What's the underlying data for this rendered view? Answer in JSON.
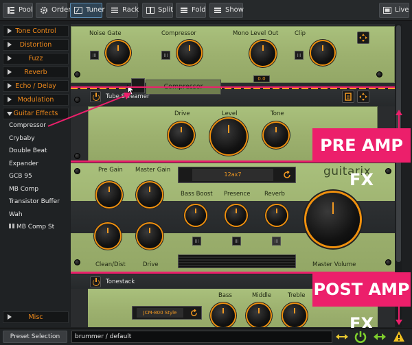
{
  "toolbar": {
    "pool": "Pool",
    "order": "Order",
    "tuner": "Tuner",
    "rack": "Rack",
    "split": "Split",
    "fold": "Fold",
    "show": "Show",
    "live": "Live"
  },
  "sidebar": {
    "categories": [
      "Tone Control",
      "Distortion",
      "Fuzz",
      "Reverb",
      "Echo / Delay",
      "Modulation",
      "Guitar Effects"
    ],
    "plugins": [
      "Compressor",
      "Crybaby",
      "Double Beat",
      "Expander",
      "GCB 95",
      "MB Comp",
      "Transistor Buffer",
      "Wah",
      "MB Comp St"
    ],
    "misc": "Misc"
  },
  "compressor_unit": {
    "labels": [
      "Noise Gate",
      "Compressor",
      "Mono Level Out",
      "Clip"
    ],
    "level_value": "0.0"
  },
  "tube_screamer": {
    "title": "Tube Screamer",
    "drag_label": "Compressor",
    "labels": [
      "Drive",
      "Level",
      "Tone"
    ]
  },
  "amp": {
    "labels_top": [
      "Pre Gain",
      "Master Gain"
    ],
    "tube": "12ax7",
    "brand": "guitarix",
    "labels_mid": [
      "Bass Boost",
      "Presence",
      "Reverb"
    ],
    "labels_bottom": [
      "Clean/Dist",
      "Drive"
    ],
    "master_volume": "Master Volume"
  },
  "tonestack": {
    "title": "Tonestack",
    "model": "JCM-800 Style",
    "labels": [
      "Bass",
      "Middle",
      "Treble"
    ]
  },
  "annotations": {
    "pre": "PRE AMP FX",
    "post": "POST AMP FX"
  },
  "bottom": {
    "preset_button": "Preset Selection",
    "preset_name": "brummer / default"
  },
  "colors": {
    "accent": "#f39a22",
    "annotation": "#ec1f6b",
    "panel_green": "#a3b975"
  }
}
